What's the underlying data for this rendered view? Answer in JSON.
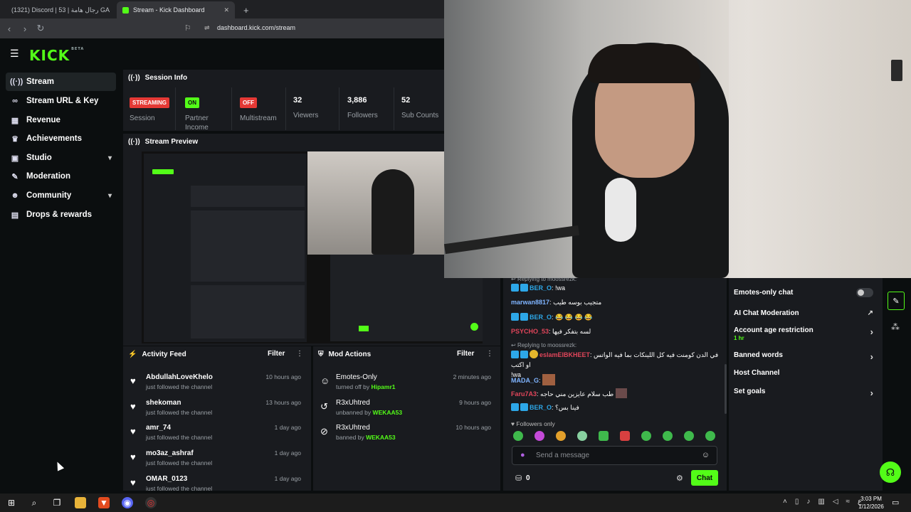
{
  "browser": {
    "tabs": [
      {
        "label": "(1321) Discord | 53 | رجال هامة GA"
      },
      {
        "label": "Stream - Kick Dashboard"
      }
    ],
    "url": "dashboard.kick.com/stream"
  },
  "sidebar": {
    "logo": "KICK",
    "logo_tag": "BETA",
    "items": [
      {
        "label": "Stream",
        "icon": "broadcast-icon"
      },
      {
        "label": "Stream URL & Key",
        "icon": "link-icon"
      },
      {
        "label": "Revenue",
        "icon": "chart-icon"
      },
      {
        "label": "Achievements",
        "icon": "trophy-icon"
      },
      {
        "label": "Studio",
        "icon": "grid-icon"
      },
      {
        "label": "Moderation",
        "icon": "wrench-icon"
      },
      {
        "label": "Community",
        "icon": "people-icon"
      },
      {
        "label": "Drops & rewards",
        "icon": "gift-icon"
      }
    ]
  },
  "session_info": {
    "title": "Session Info",
    "session_badge": "STREAMING",
    "session_label": "Session",
    "partner_badge": "ON",
    "partner_label": "Partner Income",
    "multistream_badge": "OFF",
    "multistream_label": "Multistream",
    "viewers": "32",
    "viewers_label": "Viewers",
    "followers": "3,886",
    "followers_label": "Followers",
    "subs": "52",
    "subs_label": "Sub Counts"
  },
  "stream_preview": {
    "title": "Stream Preview"
  },
  "activity_feed": {
    "title": "Activity Feed",
    "filter": "Filter",
    "items": [
      {
        "name": "AbdullahLoveKhelo",
        "sub": "just followed the channel",
        "time": "10 hours ago"
      },
      {
        "name": "shekoman",
        "sub": "just followed the channel",
        "time": "13 hours ago"
      },
      {
        "name": "amr_74",
        "sub": "just followed the channel",
        "time": "1 day ago"
      },
      {
        "name": "mo3az_ashraf",
        "sub": "just followed the channel",
        "time": "1 day ago"
      },
      {
        "name": "OMAR_0123",
        "sub": "just followed the channel",
        "time": "1 day ago"
      }
    ]
  },
  "mod_actions": {
    "title": "Mod Actions",
    "filter": "Filter",
    "items": [
      {
        "name": "Emotes-Only",
        "sub_prefix": "turned off by",
        "actor": "Hipamr1",
        "time": "2 minutes ago"
      },
      {
        "name": "R3xUhtred",
        "sub_prefix": "unbanned by",
        "actor": "WEKAA53",
        "time": "9 hours ago"
      },
      {
        "name": "R3xUhtred",
        "sub_prefix": "banned by",
        "actor": "WEKAA53",
        "time": "10 hours ago"
      }
    ]
  },
  "chat": {
    "reply1": "Replying to moossrezk:",
    "msgs": [
      {
        "user": "BER_O",
        "color": "#2da7e8",
        "text": "!wa"
      },
      {
        "user": "marwan8817",
        "color": "#7fb4ff",
        "text": "متجيب بوسه طيب"
      },
      {
        "user": "BER_O",
        "color": "#2da7e8",
        "text": "😂 😂 😂 😂"
      },
      {
        "user": "PSYCHO_53",
        "color": "#e0455a",
        "text": "لسه بتفكر فيها"
      }
    ],
    "reply2": "Replying to moossrezk:",
    "long_user": "eslamElBKHEET",
    "long_text": "في الدن كومنت فيه كل اللينكات بما فيه الواتس او اكتب",
    "long_text2": "!wa",
    "msgs2": [
      {
        "user": "MADA_G",
        "color": "#7fb4ff",
        "text": ""
      },
      {
        "user": "Faru7A3",
        "color": "#e0455a",
        "text": "طب سلام عايزين مني حاجه"
      },
      {
        "user": "BER_O",
        "color": "#2da7e8",
        "text": "فينا بس؟"
      }
    ],
    "followers_only": "Followers only",
    "placeholder": "Send a message",
    "count": "0",
    "send": "Chat"
  },
  "mod_tools": {
    "emotes_only": "Emotes-only chat",
    "ai_mod": "AI Chat Moderation",
    "age_restriction": "Account age restriction",
    "age_value": "1 hr",
    "banned_words": "Banned words",
    "host_channel": "Host Channel",
    "set_goals": "Set goals"
  },
  "taskbar": {
    "time": "3:03 PM",
    "date": "1/12/2026",
    "lang": "ع"
  },
  "colors": {
    "accent": "#53fc18",
    "danger": "#e53935",
    "panel": "#191b1f"
  }
}
